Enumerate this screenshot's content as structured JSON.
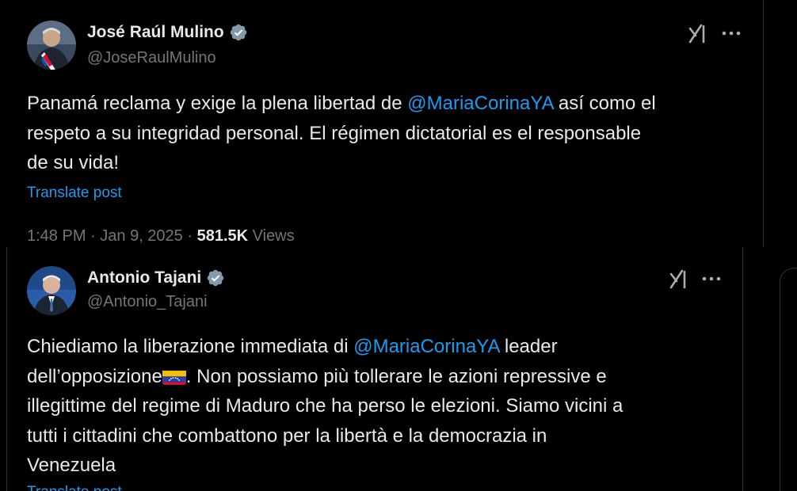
{
  "posts": [
    {
      "author": "José Raúl Mulino",
      "handle": "@JoseRaulMulino",
      "text_lines": [
        [
          "Panamá reclama y exige la plena libertad de ",
          "@MariaCorinaYA",
          " así como el"
        ],
        [
          "respeto a su integridad personal. El régimen dictatorial es el responsable"
        ],
        [
          "de su vida!"
        ]
      ],
      "translate_label": "Translate post",
      "time": "1:48 PM",
      "date": "Jan 9, 2025",
      "views_count": "581.5K",
      "views_label": "Views"
    },
    {
      "author": "Antonio Tajani",
      "handle": "@Antonio_Tajani",
      "line1_pre": "Chiediamo la liberazione immediata di ",
      "line1_mention": "@MariaCorinaYA",
      "line1_post": " leader",
      "line2_pre": "dell’opposizione",
      "line2_post": ". Non possiamo più tollerare le azioni repressive e",
      "line3": "illegittime del regime di Maduro che ha perso le elezioni. Siamo vicini a",
      "line4": "tutti i cittadini che combattono per la libertà e la democrazia in",
      "line5": "Venezuela",
      "translate_label": "Translate post"
    }
  ],
  "icons": [
    "verified-badge-icon",
    "grok-icon",
    "more-icon",
    "venezuela-flag-icon"
  ],
  "colors": {
    "background": "#000000",
    "text": "#e7e9ea",
    "secondary": "#71767b",
    "link": "#1d9bf0",
    "border": "#2f3336",
    "verified": "#829aab"
  }
}
